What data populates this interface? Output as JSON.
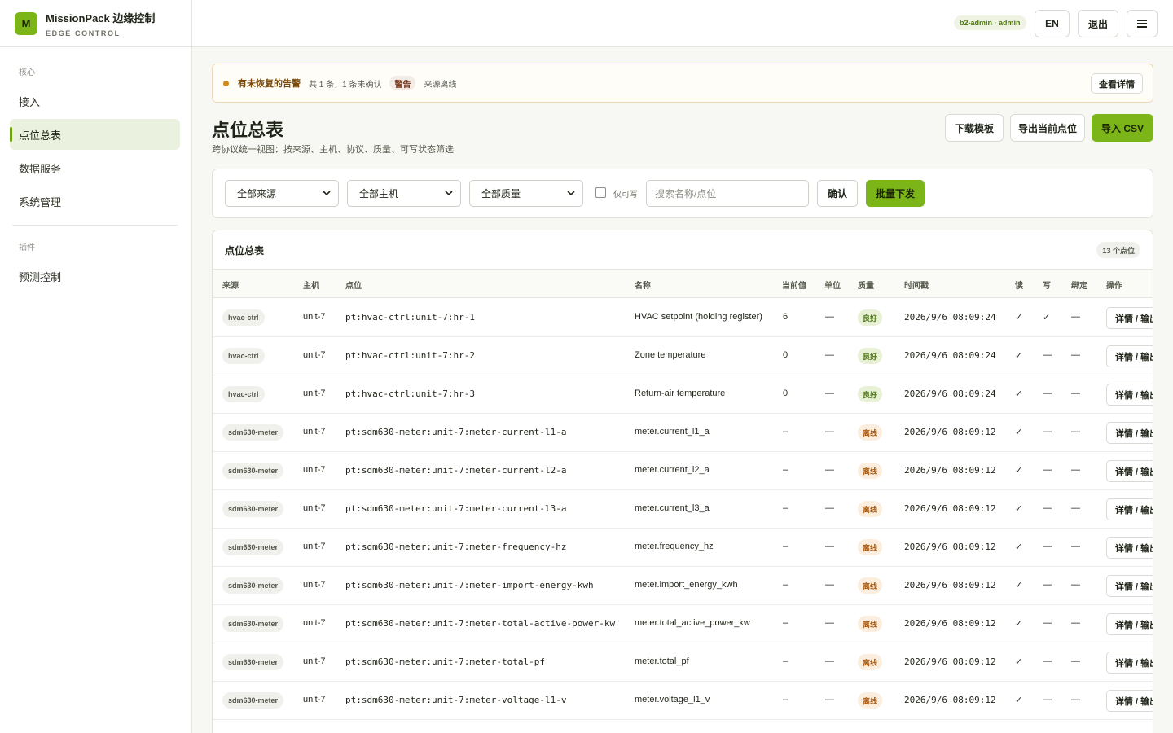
{
  "brand": {
    "logo": "M",
    "title": "MissionPack 边缘控制",
    "subtitle": "EDGE CONTROL"
  },
  "sidebar": {
    "section_core": "核心",
    "items": [
      {
        "label": "接入",
        "active": false
      },
      {
        "label": "点位总表",
        "active": true
      },
      {
        "label": "数据服务",
        "active": false
      },
      {
        "label": "系统管理",
        "active": false
      }
    ],
    "section_plugins": "插件",
    "plugin_items": [
      {
        "label": "预测控制"
      }
    ]
  },
  "topbar": {
    "user": "b2-admin · admin",
    "lang": "EN",
    "logout": "退出",
    "menu_icon": "hamburger-icon"
  },
  "alert": {
    "title": "有未恢复的告警",
    "summary": "共 1 条，1 条未确认",
    "level": "警告",
    "source": "来源离线",
    "action": "查看详情"
  },
  "page": {
    "title": "点位总表",
    "subtitle": "跨协议统一视图：按来源、主机、协议、质量、可写状态筛选",
    "download_template": "下载模板",
    "export_current": "导出当前点位",
    "import_csv": "导入 CSV"
  },
  "filters": {
    "source": "全部来源",
    "host": "全部主机",
    "quality": "全部质量",
    "writable_only": "仅可写",
    "search_placeholder": "搜索名称/点位",
    "confirm": "确认",
    "batch_send": "批量下发"
  },
  "table": {
    "title": "点位总表",
    "count": "13 个点位",
    "headers": [
      "来源",
      "主机",
      "点位",
      "名称",
      "当前值",
      "单位",
      "质量",
      "时间戳",
      "读",
      "写",
      "绑定",
      "操作"
    ],
    "rows": [
      {
        "source": "hvac-ctrl",
        "host": "unit-7",
        "point": "pt:hvac-ctrl:unit-7:hr-1",
        "name": "HVAC setpoint (holding register)",
        "value": "6",
        "unit": "—",
        "quality": "良好",
        "q": "good",
        "ts": "2026/9/6 08:09:24",
        "read": "✓",
        "write": "✓",
        "bind": "—",
        "op": "详情 / 输出"
      },
      {
        "source": "hvac-ctrl",
        "host": "unit-7",
        "point": "pt:hvac-ctrl:unit-7:hr-2",
        "name": "Zone temperature",
        "value": "0",
        "unit": "—",
        "quality": "良好",
        "q": "good",
        "ts": "2026/9/6 08:09:24",
        "read": "✓",
        "write": "—",
        "bind": "—",
        "op": "详情 / 输出"
      },
      {
        "source": "hvac-ctrl",
        "host": "unit-7",
        "point": "pt:hvac-ctrl:unit-7:hr-3",
        "name": "Return-air temperature",
        "value": "0",
        "unit": "—",
        "quality": "良好",
        "q": "good",
        "ts": "2026/9/6 08:09:24",
        "read": "✓",
        "write": "—",
        "bind": "—",
        "op": "详情 / 输出"
      },
      {
        "source": "sdm630-meter",
        "host": "unit-7",
        "point": "pt:sdm630-meter:unit-7:meter-current-l1-a",
        "name": "meter.current_l1_a",
        "value": "–",
        "unit": "—",
        "quality": "离线",
        "q": "off",
        "ts": "2026/9/6 08:09:12",
        "read": "✓",
        "write": "—",
        "bind": "—",
        "op": "详情 / 输出"
      },
      {
        "source": "sdm630-meter",
        "host": "unit-7",
        "point": "pt:sdm630-meter:unit-7:meter-current-l2-a",
        "name": "meter.current_l2_a",
        "value": "–",
        "unit": "—",
        "quality": "离线",
        "q": "off",
        "ts": "2026/9/6 08:09:12",
        "read": "✓",
        "write": "—",
        "bind": "—",
        "op": "详情 / 输出"
      },
      {
        "source": "sdm630-meter",
        "host": "unit-7",
        "point": "pt:sdm630-meter:unit-7:meter-current-l3-a",
        "name": "meter.current_l3_a",
        "value": "–",
        "unit": "—",
        "quality": "离线",
        "q": "off",
        "ts": "2026/9/6 08:09:12",
        "read": "✓",
        "write": "—",
        "bind": "—",
        "op": "详情 / 输出"
      },
      {
        "source": "sdm630-meter",
        "host": "unit-7",
        "point": "pt:sdm630-meter:unit-7:meter-frequency-hz",
        "name": "meter.frequency_hz",
        "value": "–",
        "unit": "—",
        "quality": "离线",
        "q": "off",
        "ts": "2026/9/6 08:09:12",
        "read": "✓",
        "write": "—",
        "bind": "—",
        "op": "详情 / 输出"
      },
      {
        "source": "sdm630-meter",
        "host": "unit-7",
        "point": "pt:sdm630-meter:unit-7:meter-import-energy-kwh",
        "name": "meter.import_energy_kwh",
        "value": "–",
        "unit": "—",
        "quality": "离线",
        "q": "off",
        "ts": "2026/9/6 08:09:12",
        "read": "✓",
        "write": "—",
        "bind": "—",
        "op": "详情 / 输出"
      },
      {
        "source": "sdm630-meter",
        "host": "unit-7",
        "point": "pt:sdm630-meter:unit-7:meter-total-active-power-kw",
        "name": "meter.total_active_power_kw",
        "value": "–",
        "unit": "—",
        "quality": "离线",
        "q": "off",
        "ts": "2026/9/6 08:09:12",
        "read": "✓",
        "write": "—",
        "bind": "—",
        "op": "详情 / 输出"
      },
      {
        "source": "sdm630-meter",
        "host": "unit-7",
        "point": "pt:sdm630-meter:unit-7:meter-total-pf",
        "name": "meter.total_pf",
        "value": "–",
        "unit": "—",
        "quality": "离线",
        "q": "off",
        "ts": "2026/9/6 08:09:12",
        "read": "✓",
        "write": "—",
        "bind": "—",
        "op": "详情 / 输出"
      },
      {
        "source": "sdm630-meter",
        "host": "unit-7",
        "point": "pt:sdm630-meter:unit-7:meter-voltage-l1-v",
        "name": "meter.voltage_l1_v",
        "value": "–",
        "unit": "—",
        "quality": "离线",
        "q": "off",
        "ts": "2026/9/6 08:09:12",
        "read": "✓",
        "write": "—",
        "bind": "—",
        "op": "详情 / 输出"
      }
    ]
  }
}
